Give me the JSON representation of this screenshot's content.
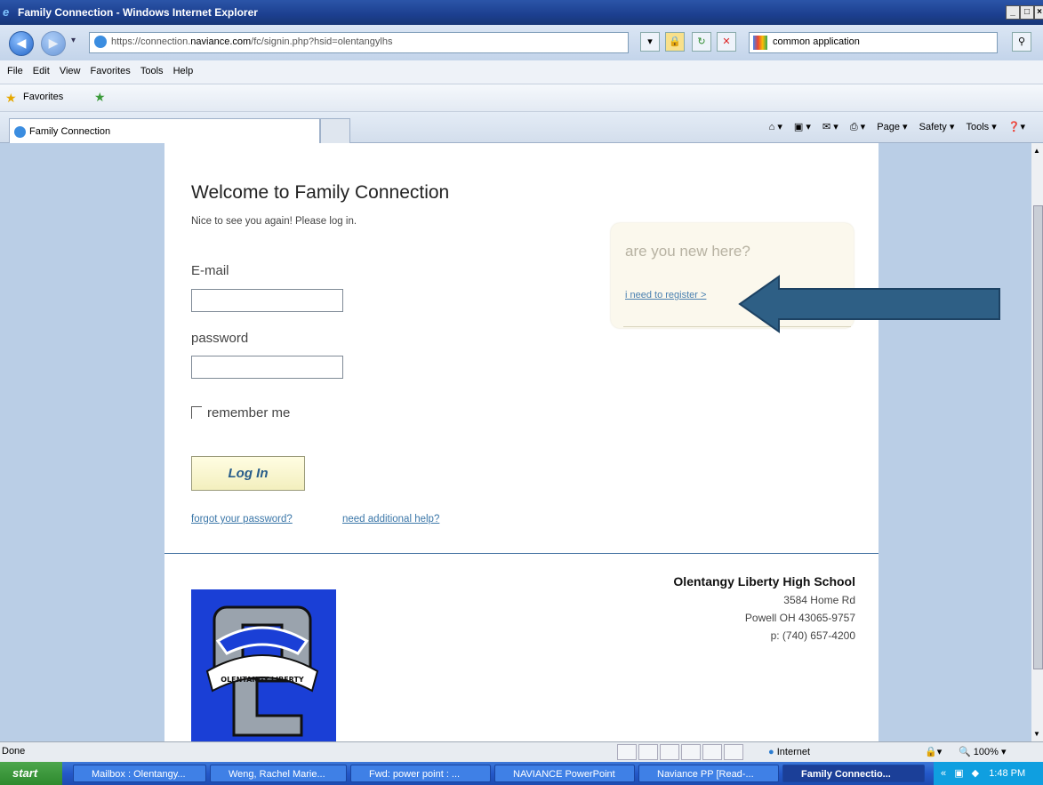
{
  "window": {
    "title": "Family Connection - Windows Internet Explorer"
  },
  "nav": {
    "url_prefix": "https://connection.",
    "url_domain": "naviance.com",
    "url_rest": "/fc/signin.php?hsid=olentangylhs",
    "search_value": "common application"
  },
  "menu": [
    "File",
    "Edit",
    "View",
    "Favorites",
    "Tools",
    "Help"
  ],
  "favorites": {
    "label": "Favorites"
  },
  "tabs": {
    "active": "Family Connection"
  },
  "command_bar": {
    "page": "Page ▾",
    "safety": "Safety ▾",
    "tools": "Tools ▾"
  },
  "login": {
    "heading": "Welcome to Family Connection",
    "subheading": "Nice to see you again! Please log in.",
    "email_label": "E-mail",
    "email_value": "",
    "password_label": "password",
    "password_value": "",
    "remember_label": "remember me",
    "login_button": "Log In",
    "forgot_link": "forgot your password?",
    "help_link": "need additional help?"
  },
  "new_user": {
    "question": "are you new here?",
    "register_link": "i need to register >"
  },
  "school": {
    "name": "Olentangy Liberty High School",
    "street": "3584 Home Rd",
    "city": "Powell OH 43065-9757",
    "phone": "p: (740) 657-4200",
    "logo_text": "OLENTANGY LIBERTY"
  },
  "status": {
    "text": "Done",
    "zone": "Internet",
    "zoom": "100%"
  },
  "taskbar": {
    "start": "start",
    "tasks": [
      "Mailbox : Olentangy...",
      "Weng, Rachel Marie...",
      "Fwd: power point : ...",
      "NAVIANCE PowerPoint",
      "Naviance PP [Read-...",
      "Family Connectio..."
    ],
    "clock": "1:48 PM"
  },
  "colors": {
    "accent_arrow": "#2e5f85",
    "link": "#3a76a8",
    "divider": "#3f6f9f"
  }
}
